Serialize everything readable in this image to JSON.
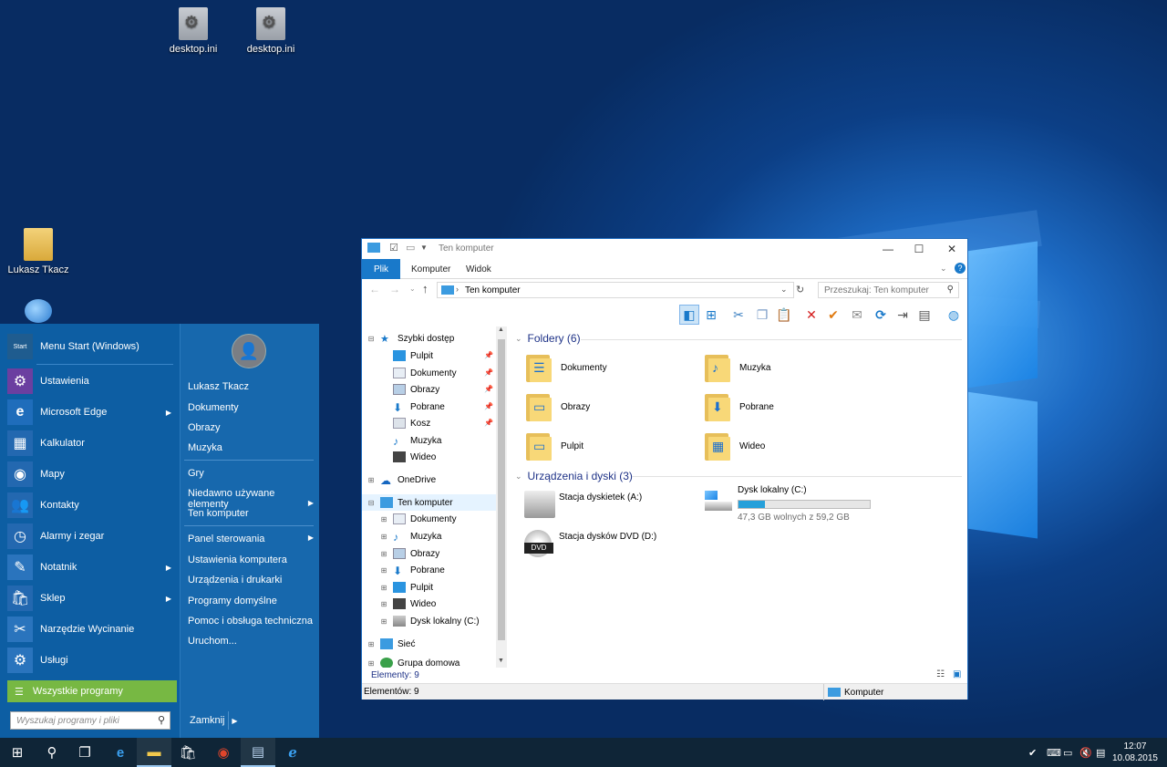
{
  "desktop": {
    "icons": [
      {
        "label": "desktop.ini"
      },
      {
        "label": "desktop.ini"
      },
      {
        "label": "Lukasz Tkacz"
      }
    ]
  },
  "start_menu": {
    "programs": [
      {
        "label": "Menu Start (Windows)",
        "icon": "start-menu-icon",
        "color": "#1f5c8f"
      },
      {
        "label": "Ustawienia",
        "icon": "gear-icon",
        "color": "#6b3fa0"
      },
      {
        "label": "Microsoft Edge",
        "icon": "edge-icon",
        "color": "#1f6dbb",
        "submenu": true
      },
      {
        "label": "Kalkulator",
        "icon": "calculator-icon",
        "color": "#2368b0"
      },
      {
        "label": "Mapy",
        "icon": "maps-icon",
        "color": "#2368b0"
      },
      {
        "label": "Kontakty",
        "icon": "contacts-icon",
        "color": "#2368b0"
      },
      {
        "label": "Alarmy i zegar",
        "icon": "alarm-clock-icon",
        "color": "#2368b0"
      },
      {
        "label": "Notatnik",
        "icon": "notepad-icon",
        "color": "#2a74bd",
        "submenu": true
      },
      {
        "label": "Sklep",
        "icon": "store-icon",
        "color": "#2368b0",
        "submenu": true
      },
      {
        "label": "Narzędzie Wycinanie",
        "icon": "snipping-tool-icon",
        "color": "#2a74bd"
      },
      {
        "label": "Usługi",
        "icon": "services-icon",
        "color": "#2a74bd"
      }
    ],
    "all_programs": "Wszystkie programy",
    "search_placeholder": "Wyszukaj programy i pliki",
    "user_name": "Lukasz Tkacz",
    "right_items": [
      {
        "label": "Dokumenty"
      },
      {
        "label": "Obrazy"
      },
      {
        "label": "Muzyka"
      },
      {
        "label": "Gry"
      },
      {
        "label": "Niedawno używane elementy",
        "submenu": true
      },
      {
        "label": "Ten komputer"
      },
      {
        "label": "Panel sterowania",
        "submenu": true
      },
      {
        "label": "Ustawienia komputera"
      },
      {
        "label": "Urządzenia i drukarki"
      },
      {
        "label": "Programy domyślne"
      },
      {
        "label": "Pomoc i obsługa techniczna"
      },
      {
        "label": "Uruchom..."
      }
    ],
    "shutdown_label": "Zamknij"
  },
  "explorer": {
    "title": "Ten komputer",
    "tabs": [
      "Plik",
      "Komputer",
      "Widok"
    ],
    "address": "Ten komputer",
    "search_placeholder": "Przeszukaj: Ten komputer",
    "nav": {
      "quick_access": "Szybki dostęp",
      "quick_items": [
        "Pulpit",
        "Dokumenty",
        "Obrazy",
        "Pobrane",
        "Kosz",
        "Muzyka",
        "Wideo"
      ],
      "onedrive": "OneDrive",
      "this_pc": "Ten komputer",
      "pc_items": [
        "Dokumenty",
        "Muzyka",
        "Obrazy",
        "Pobrane",
        "Pulpit",
        "Wideo",
        "Dysk lokalny (C:)"
      ],
      "network": "Sieć",
      "homegroup": "Grupa domowa"
    },
    "folders_header": "Foldery (6)",
    "folders": [
      {
        "name": "Dokumenty",
        "glyph": "☰"
      },
      {
        "name": "Muzyka",
        "glyph": "♪"
      },
      {
        "name": "Obrazy",
        "glyph": "▭"
      },
      {
        "name": "Pobrane",
        "glyph": "⬇"
      },
      {
        "name": "Pulpit",
        "glyph": "▭"
      },
      {
        "name": "Wideo",
        "glyph": "▦"
      }
    ],
    "devices_header": "Urządzenia i dyski (3)",
    "devices": [
      {
        "name": "Stacja dyskietek (A:)"
      },
      {
        "name": "Dysk lokalny (C:)",
        "free": "47,3 GB wolnych z 59,2 GB",
        "used_fraction": 0.2
      },
      {
        "name": "Stacja dysków DVD (D:)"
      }
    ],
    "status_inner": "Elementy: 9",
    "status_outer": "Elementów: 9",
    "status_computer": "Komputer"
  },
  "taskbar": {
    "time": "12:07",
    "date": "10.08.2015"
  }
}
